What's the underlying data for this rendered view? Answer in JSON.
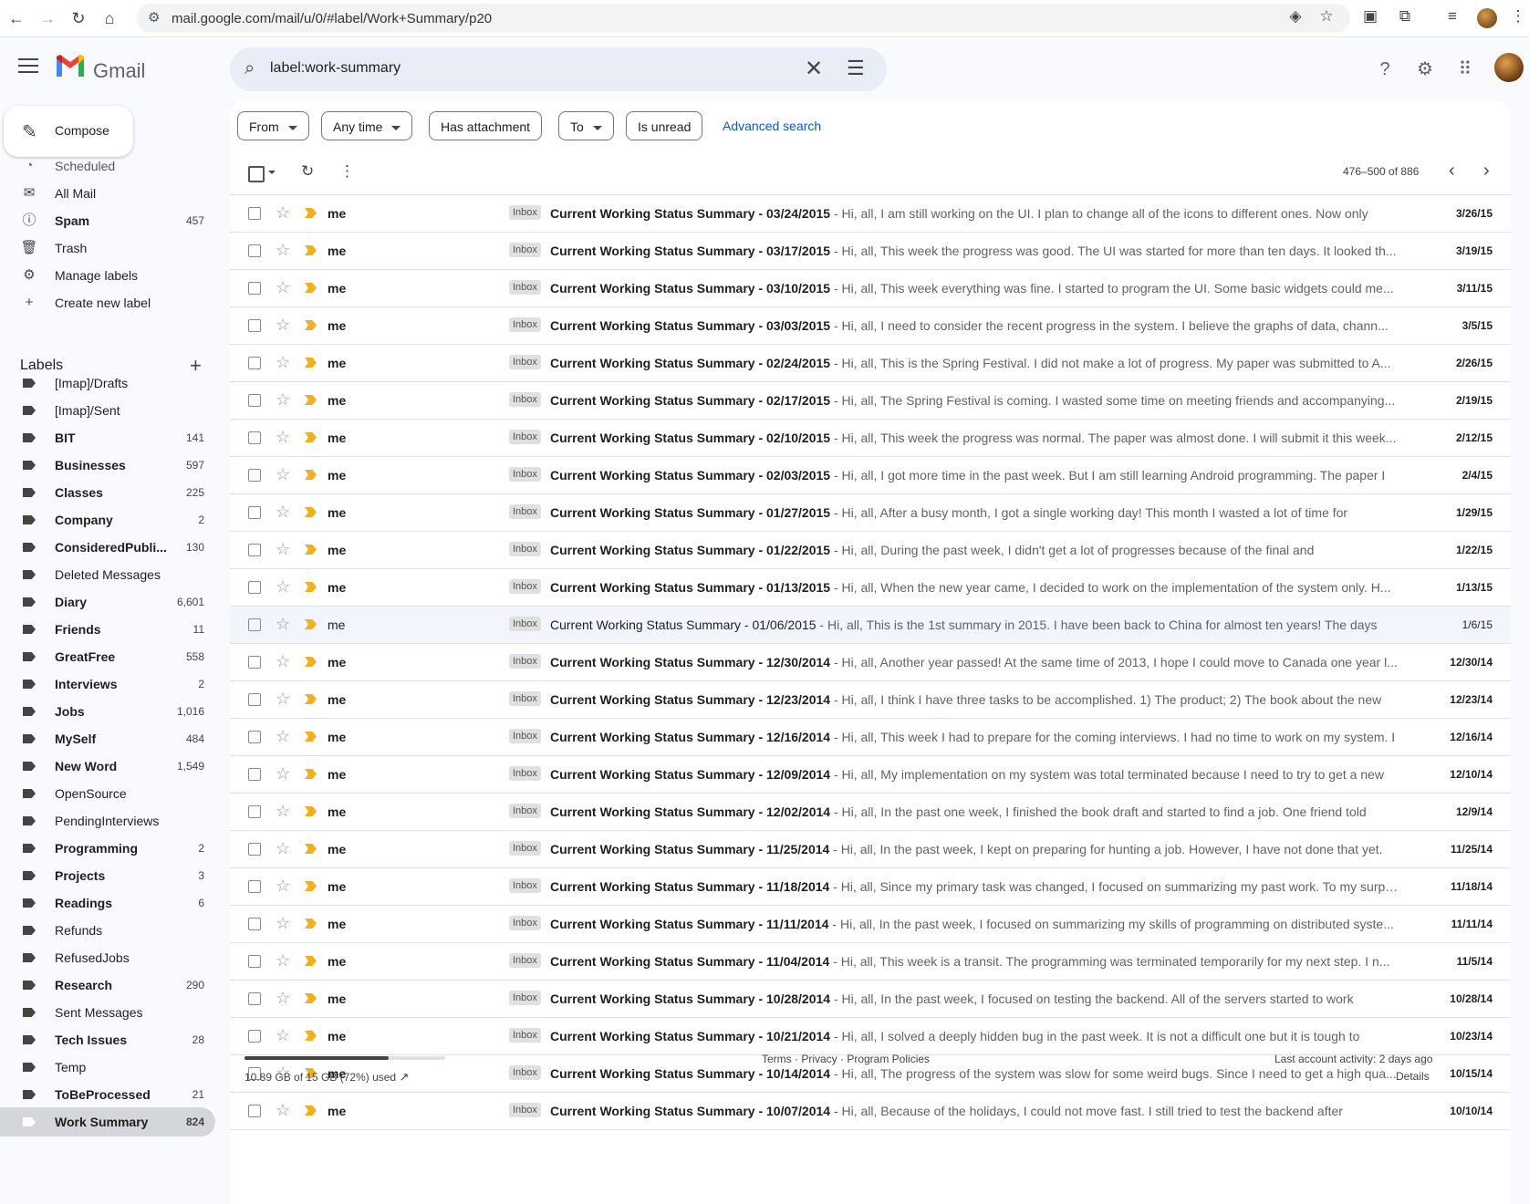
{
  "browser": {
    "url": "mail.google.com/mail/u/0/#label/Work+Summary/p20"
  },
  "app": {
    "name": "Gmail"
  },
  "search": {
    "query": "label:work-summary"
  },
  "compose_label": "Compose",
  "nav": [
    {
      "label": "Scheduled",
      "icon": "scheduled-icon"
    },
    {
      "label": "All Mail",
      "icon": "all-mail-icon"
    },
    {
      "label": "Spam",
      "icon": "spam-icon",
      "count": "457",
      "bold": true
    },
    {
      "label": "Trash",
      "icon": "trash-icon"
    },
    {
      "label": "Manage labels",
      "icon": "gear-icon"
    },
    {
      "label": "Create new label",
      "icon": "plus-icon"
    }
  ],
  "labels_title": "Labels",
  "labels": [
    {
      "label": "[Imap]/Drafts",
      "count": ""
    },
    {
      "label": "[Imap]/Sent",
      "count": ""
    },
    {
      "label": "BIT",
      "count": "141",
      "bold": true
    },
    {
      "label": "Businesses",
      "count": "597",
      "bold": true
    },
    {
      "label": "Classes",
      "count": "225",
      "bold": true
    },
    {
      "label": "Company",
      "count": "2",
      "bold": true
    },
    {
      "label": "ConsideredPubli...",
      "count": "130",
      "bold": true
    },
    {
      "label": "Deleted Messages",
      "count": ""
    },
    {
      "label": "Diary",
      "count": "6,601",
      "bold": true
    },
    {
      "label": "Friends",
      "count": "11",
      "bold": true
    },
    {
      "label": "GreatFree",
      "count": "558",
      "bold": true
    },
    {
      "label": "Interviews",
      "count": "2",
      "bold": true
    },
    {
      "label": "Jobs",
      "count": "1,016",
      "bold": true
    },
    {
      "label": "MySelf",
      "count": "484",
      "bold": true
    },
    {
      "label": "New Word",
      "count": "1,549",
      "bold": true
    },
    {
      "label": "OpenSource",
      "count": ""
    },
    {
      "label": "PendingInterviews",
      "count": ""
    },
    {
      "label": "Programming",
      "count": "2",
      "bold": true
    },
    {
      "label": "Projects",
      "count": "3",
      "bold": true
    },
    {
      "label": "Readings",
      "count": "6",
      "bold": true
    },
    {
      "label": "Refunds",
      "count": ""
    },
    {
      "label": "RefusedJobs",
      "count": ""
    },
    {
      "label": "Research",
      "count": "290",
      "bold": true
    },
    {
      "label": "Sent Messages",
      "count": ""
    },
    {
      "label": "Tech Issues",
      "count": "28",
      "bold": true
    },
    {
      "label": "Temp",
      "count": ""
    },
    {
      "label": "ToBeProcessed",
      "count": "21",
      "bold": true
    },
    {
      "label": "Work Summary",
      "count": "824",
      "bold": true,
      "active": true
    }
  ],
  "filters": {
    "from": "From",
    "any_time": "Any time",
    "has_attachment": "Has attachment",
    "to": "To",
    "is_unread": "Is unread",
    "advanced": "Advanced search"
  },
  "pager": {
    "range": "476–500 of 886"
  },
  "emails": [
    {
      "sender": "me",
      "badge": "Inbox",
      "subject": "Current Working Status Summary - 03/24/2015",
      "snippet": " - Hi, all, I am still working on the UI. I plan to change all of the icons to different ones. Now only",
      "date": "3/26/15",
      "read": false
    },
    {
      "sender": "me",
      "badge": "Inbox",
      "subject": "Current Working Status Summary - 03/17/2015",
      "snippet": " - Hi, all, This week the progress was good. The UI was started for more than ten days. It looked th...",
      "date": "3/19/15",
      "read": false
    },
    {
      "sender": "me",
      "badge": "Inbox",
      "subject": "Current Working Status Summary - 03/10/2015",
      "snippet": " - Hi, all, This week everything was fine. I started to program the UI. Some basic widgets could me...",
      "date": "3/11/15",
      "read": false
    },
    {
      "sender": "me",
      "badge": "Inbox",
      "subject": "Current Working Status Summary - 03/03/2015",
      "snippet": " - Hi, all, I need to consider the recent progress in the system. I believe the graphs of data, chann...",
      "date": "3/5/15",
      "read": false
    },
    {
      "sender": "me",
      "badge": "Inbox",
      "subject": "Current Working Status Summary - 02/24/2015",
      "snippet": " - Hi, all, This is the Spring Festival. I did not make a lot of progress. My paper was submitted to A...",
      "date": "2/26/15",
      "read": false
    },
    {
      "sender": "me",
      "badge": "Inbox",
      "subject": "Current Working Status Summary - 02/17/2015",
      "snippet": " - Hi, all, The Spring Festival is coming. I wasted some time on meeting friends and accompanying...",
      "date": "2/19/15",
      "read": false
    },
    {
      "sender": "me",
      "badge": "Inbox",
      "subject": "Current Working Status Summary - 02/10/2015",
      "snippet": " - Hi, all, This week the progress was normal. The paper was almost done. I will submit it this week...",
      "date": "2/12/15",
      "read": false
    },
    {
      "sender": "me",
      "badge": "Inbox",
      "subject": "Current Working Status Summary - 02/03/2015",
      "snippet": " - Hi, all, I got more time in the past week. But I am still learning Android programming. The paper I",
      "date": "2/4/15",
      "read": false
    },
    {
      "sender": "me",
      "badge": "Inbox",
      "subject": "Current Working Status Summary - 01/27/2015",
      "snippet": " - Hi, all, After a busy month, I got a single working day! This month I wasted a lot of time for",
      "date": "1/29/15",
      "read": false
    },
    {
      "sender": "me",
      "badge": "Inbox",
      "subject": "Current Working Status Summary - 01/22/2015",
      "snippet": " - Hi, all, During the past week, I didn't get a lot of progresses because of the final and",
      "date": "1/22/15",
      "read": false
    },
    {
      "sender": "me",
      "badge": "Inbox",
      "subject": "Current Working Status Summary - 01/13/2015",
      "snippet": " - Hi, all, When the new year came, I decided to work on the implementation of the system only. H...",
      "date": "1/13/15",
      "read": false
    },
    {
      "sender": "me",
      "badge": "Inbox",
      "subject": "Current Working Status Summary - 01/06/2015",
      "snippet": " - Hi, all, This is the 1st summary in 2015. I have been back to China for almost ten years! The days",
      "date": "1/6/15",
      "read": true
    },
    {
      "sender": "me",
      "badge": "Inbox",
      "subject": "Current Working Status Summary - 12/30/2014",
      "snippet": " - Hi, all, Another year passed! At the same time of 2013, I hope I could move to Canada one year l...",
      "date": "12/30/14",
      "read": false
    },
    {
      "sender": "me",
      "badge": "Inbox",
      "subject": "Current Working Status Summary - 12/23/2014",
      "snippet": " - Hi, all, I think I have three tasks to be accomplished. 1) The product; 2) The book about the new",
      "date": "12/23/14",
      "read": false
    },
    {
      "sender": "me",
      "badge": "Inbox",
      "subject": "Current Working Status Summary - 12/16/2014",
      "snippet": " - Hi, all, This week I had to prepare for the coming interviews. I had no time to work on my system. I",
      "date": "12/16/14",
      "read": false
    },
    {
      "sender": "me",
      "badge": "Inbox",
      "subject": "Current Working Status Summary - 12/09/2014",
      "snippet": " - Hi, all, My implementation on my system was total terminated because I need to try to get a new",
      "date": "12/10/14",
      "read": false
    },
    {
      "sender": "me",
      "badge": "Inbox",
      "subject": "Current Working Status Summary - 12/02/2014",
      "snippet": " - Hi, all, In the past one week, I finished the book draft and started to find a job. One friend told",
      "date": "12/9/14",
      "read": false
    },
    {
      "sender": "me",
      "badge": "Inbox",
      "subject": "Current Working Status Summary - 11/25/2014",
      "snippet": " - Hi, all, In the past week, I kept on preparing for hunting a job. However, I have not done that yet.",
      "date": "11/25/14",
      "read": false
    },
    {
      "sender": "me",
      "badge": "Inbox",
      "subject": "Current Working Status Summary - 11/18/2014",
      "snippet": " - Hi, all, Since my primary task was changed, I focused on summarizing my past work. To my surpr...",
      "date": "11/18/14",
      "read": false
    },
    {
      "sender": "me",
      "badge": "Inbox",
      "subject": "Current Working Status Summary - 11/11/2014",
      "snippet": " - Hi, all, In the past week, I focused on summarizing my skills of programming on distributed syste...",
      "date": "11/11/14",
      "read": false
    },
    {
      "sender": "me",
      "badge": "Inbox",
      "subject": "Current Working Status Summary - 11/04/2014",
      "snippet": " - Hi, all, This week is a transit. The programming was terminated temporarily for my next step. I n...",
      "date": "11/5/14",
      "read": false
    },
    {
      "sender": "me",
      "badge": "Inbox",
      "subject": "Current Working Status Summary - 10/28/2014",
      "snippet": " - Hi, all, In the past week, I focused on testing the backend. All of the servers started to work",
      "date": "10/28/14",
      "read": false
    },
    {
      "sender": "me",
      "badge": "Inbox",
      "subject": "Current Working Status Summary - 10/21/2014",
      "snippet": " - Hi, all, I solved a deeply hidden bug in the past week. It is not a difficult one but it is tough to",
      "date": "10/23/14",
      "read": false
    },
    {
      "sender": "me",
      "badge": "Inbox",
      "subject": "Current Working Status Summary - 10/14/2014",
      "snippet": " - Hi, all, The progress of the system was slow for some weird bugs. Since I need to get a high qua...",
      "date": "10/15/14",
      "read": false
    },
    {
      "sender": "me",
      "badge": "Inbox",
      "subject": "Current Working Status Summary - 10/07/2014",
      "snippet": " - Hi, all, Because of the holidays, I could not move fast. I still tried to test the backend after",
      "date": "10/10/14",
      "read": false
    }
  ],
  "footer": {
    "storage": "10.89 GB of 15 GB (72%) used",
    "storage_fraction": 0.72,
    "links": "Terms · Privacy · Program Policies",
    "activity": "Last account activity: 2 days ago",
    "details": "Details"
  }
}
